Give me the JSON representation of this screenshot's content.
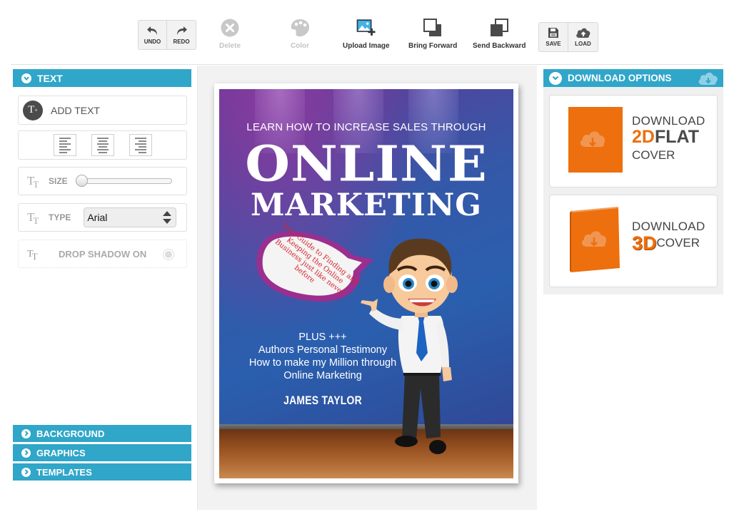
{
  "toolbar": {
    "undo_label": "UNDO",
    "redo_label": "REDO",
    "delete_label": "Delete",
    "color_label": "Color",
    "upload_label": "Upload Image",
    "bring_forward_label": "Bring Forward",
    "send_backward_label": "Send Backward",
    "save_label": "SAVE",
    "load_label": "LOAD"
  },
  "left_panel": {
    "text_section": {
      "title": "TEXT",
      "add_text_label": "ADD TEXT",
      "size_label": "SIZE",
      "size_value": 0,
      "type_label": "TYPE",
      "font_selected": "Arial",
      "drop_shadow_label": "DROP SHADOW ON",
      "drop_shadow_on": false
    },
    "collapsed_sections": [
      {
        "title": "BACKGROUND"
      },
      {
        "title": "GRAPHICS"
      },
      {
        "title": "TEMPLATES"
      }
    ]
  },
  "cover": {
    "subtitle": "LEARN HOW TO INCREASE SALES THROUGH",
    "title_line1": "ONLINE",
    "title_line2": "MARKETING",
    "bubble_text": "Your Guide to Finding and Keeping the Online Business just like never before",
    "plus_lines": [
      "PLUS +++",
      "Authors Personal Testimony",
      "How to make my Million through",
      "Online Marketing"
    ],
    "author": "JAMES TAYLOR"
  },
  "right_panel": {
    "title": "DOWNLOAD OPTIONS",
    "options": [
      {
        "line1": "DOWNLOAD",
        "accent": "2D",
        "accent_rest": "FLAT",
        "line3": "COVER"
      },
      {
        "line1": "DOWNLOAD",
        "accent": "3D",
        "accent_rest": "COVER",
        "line3": ""
      }
    ]
  },
  "colors": {
    "accent_blue": "#30a6c9",
    "download_orange": "#ed6f0e",
    "bubble_text_red": "#d4252a"
  }
}
